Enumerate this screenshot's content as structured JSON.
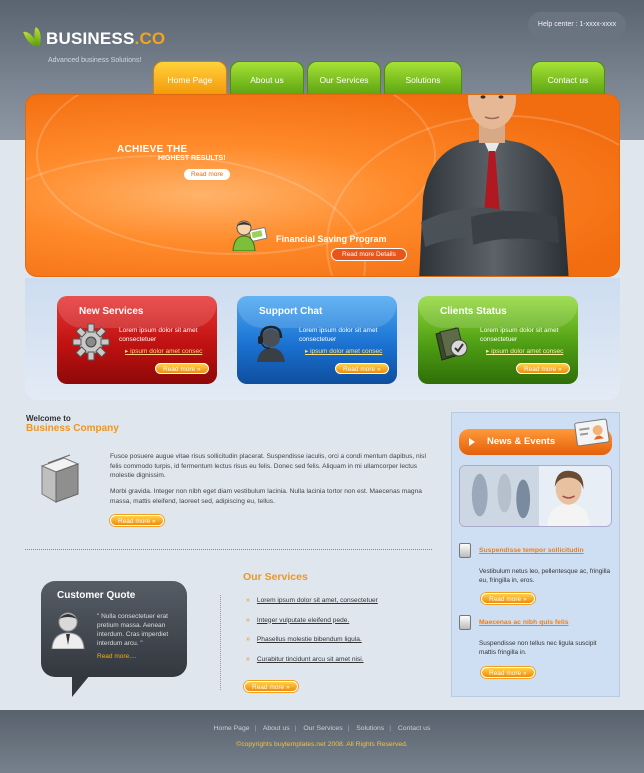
{
  "header": {
    "logo_main": "BUSINESS",
    "logo_suffix": ".CO",
    "tagline": "Advanced business Solutions!",
    "help": "Help center : 1-xxxx-xxxx"
  },
  "nav": {
    "items": [
      {
        "label": "Home Page",
        "active": true
      },
      {
        "label": "About us",
        "active": false
      },
      {
        "label": "Our Services",
        "active": false
      },
      {
        "label": "Solutions",
        "active": false
      },
      {
        "label": "Contact us",
        "active": false
      }
    ]
  },
  "hero": {
    "title": "ACHIEVE THE",
    "subtitle": "HIGHEST RESULTS!",
    "read_more": "Read more",
    "financial_title": "Financial Saving Program",
    "financial_read": "Read more Details"
  },
  "features": [
    {
      "title": "New Services",
      "text": "Lorem ipsum dolor sit amet consectetuer",
      "link": "ipsum dolor amet  consec",
      "read": "Read more"
    },
    {
      "title": "Support Chat",
      "text": "Lorem ipsum dolor sit amet consectetuer",
      "link": "ipsum dolor amet  consec",
      "read": "Read more"
    },
    {
      "title": "Clients Status",
      "text": "Lorem ipsum dolor sit amet consectetuer",
      "link": "ipsum dolor amet  consec",
      "read": "Read more"
    }
  ],
  "welcome": {
    "small": "Welcome to",
    "big": "Business Company",
    "p1": "Fusce posuere augue vitae risus sollicitudin placerat. Suspendisse iaculis, orci a condi mentum dapibus, nisl felis commodo turpis, id fermentum lectus risus eu felis. Donec sed felis. Aliquam in mi ullamcorper lectus molestie dignissim.",
    "p2": "Morbi gravida. Integer non nibh eget diam vestibulum lacinia. Nulla lacinia tortor non est. Maecenas magna massa, mattis eleifend, laoreet sed, adipiscing eu, tellus.",
    "read": "Read more"
  },
  "quote": {
    "title": "Customer Quote",
    "text": "\" Nulla consectetuer erat pretium massa. Aenean interdum. Cras imperdiet interdum arcu. \"",
    "read": "Read more...."
  },
  "services": {
    "title": "Our Services",
    "items": [
      "Lorem ipsum dolor sit amet, consectetuer",
      "Integer vulputate eleifend pede.",
      "Phasellus molestie bibendum ligula.",
      "Curabitur tincidunt arcu sit amet nisi."
    ],
    "read": "Read more"
  },
  "sidebar": {
    "title": "News & Events",
    "news": [
      {
        "title": "Suspendisse tempor sollicitudin",
        "text": "Vestibulum netus leo, pellentesque ac, fringilla eu, fringilla in, eros.",
        "read": "Read more"
      },
      {
        "title": "Maecenas ac nibh quis felis",
        "text": "Suspendisse non tellus nec ligula suscipit mattis fringilla in.",
        "read": "Read more"
      }
    ]
  },
  "footer": {
    "links": [
      "Home Page",
      "About us",
      "Our Services",
      "Solutions",
      "Contact us"
    ],
    "copyright": "©copyrights buytemplates.net 2008. All Rights Reserved."
  },
  "colors": {
    "orange": "#f0961e",
    "green_tab": "#7cc31e",
    "active_tab": "#f7b41a",
    "hero": "#ff8a2a"
  }
}
